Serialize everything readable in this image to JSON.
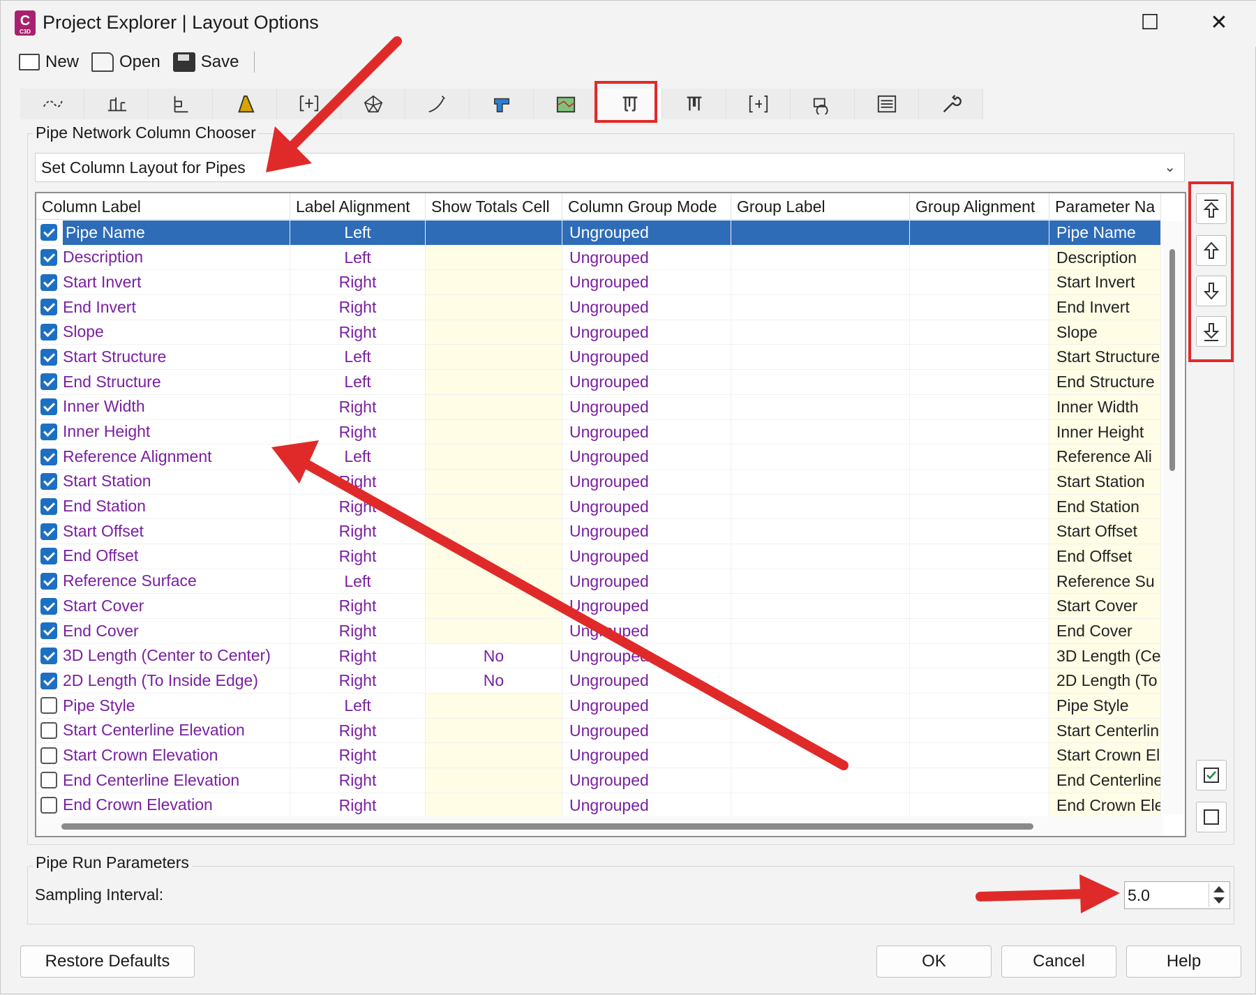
{
  "window": {
    "title": "Project Explorer | Layout Options",
    "app_icon_letter": "C",
    "app_icon_sub": "C3D",
    "maximize_glyph": "☐",
    "close_glyph": "✕"
  },
  "toolbar": {
    "new_label": "New",
    "open_label": "Open",
    "save_label": "Save"
  },
  "tabs": [
    {
      "icon": "alignment-icon"
    },
    {
      "icon": "profile-icon"
    },
    {
      "icon": "profile-view-icon"
    },
    {
      "icon": "corridor-icon"
    },
    {
      "icon": "sample-line-icon"
    },
    {
      "icon": "surface-icon"
    },
    {
      "icon": "feature-line-icon"
    },
    {
      "icon": "assembly-icon"
    },
    {
      "icon": "parcel-icon"
    },
    {
      "icon": "pipe-network-icon",
      "active": true
    },
    {
      "icon": "pressure-network-icon"
    },
    {
      "icon": "section-view-icon"
    },
    {
      "icon": "point-group-icon"
    },
    {
      "icon": "list-icon"
    },
    {
      "icon": "wrench-icon"
    }
  ],
  "chooser": {
    "group_label": "Pipe Network Column Chooser",
    "dropdown_value": "Set Column Layout for Pipes"
  },
  "grid": {
    "headers": [
      "Column Label",
      "Label Alignment",
      "Show Totals Cell",
      "Column Group Mode",
      "Group Label",
      "Group Alignment",
      "Parameter Na"
    ],
    "rows": [
      {
        "checked": true,
        "label": "Pipe Name",
        "align": "Left",
        "totals": "",
        "mode": "Ungrouped",
        "group": "",
        "galign": "",
        "param": "Pipe Name",
        "selected": true
      },
      {
        "checked": true,
        "label": "Description",
        "align": "Left",
        "totals": "",
        "mode": "Ungrouped",
        "group": "",
        "galign": "",
        "param": "Description"
      },
      {
        "checked": true,
        "label": "Start Invert",
        "align": "Right",
        "totals": "",
        "mode": "Ungrouped",
        "group": "",
        "galign": "",
        "param": "Start Invert"
      },
      {
        "checked": true,
        "label": "End Invert",
        "align": "Right",
        "totals": "",
        "mode": "Ungrouped",
        "group": "",
        "galign": "",
        "param": "End Invert"
      },
      {
        "checked": true,
        "label": "Slope",
        "align": "Right",
        "totals": "",
        "mode": "Ungrouped",
        "group": "",
        "galign": "",
        "param": "Slope"
      },
      {
        "checked": true,
        "label": "Start Structure",
        "align": "Left",
        "totals": "",
        "mode": "Ungrouped",
        "group": "",
        "galign": "",
        "param": "Start Structure"
      },
      {
        "checked": true,
        "label": "End Structure",
        "align": "Left",
        "totals": "",
        "mode": "Ungrouped",
        "group": "",
        "galign": "",
        "param": "End Structure"
      },
      {
        "checked": true,
        "label": "Inner Width",
        "align": "Right",
        "totals": "",
        "mode": "Ungrouped",
        "group": "",
        "galign": "",
        "param": "Inner Width"
      },
      {
        "checked": true,
        "label": "Inner Height",
        "align": "Right",
        "totals": "",
        "mode": "Ungrouped",
        "group": "",
        "galign": "",
        "param": "Inner Height"
      },
      {
        "checked": true,
        "label": "Reference Alignment",
        "align": "Left",
        "totals": "",
        "mode": "Ungrouped",
        "group": "",
        "galign": "",
        "param": "Reference Ali"
      },
      {
        "checked": true,
        "label": "Start Station",
        "align": "Right",
        "totals": "",
        "mode": "Ungrouped",
        "group": "",
        "galign": "",
        "param": "Start Station"
      },
      {
        "checked": true,
        "label": "End Station",
        "align": "Right",
        "totals": "",
        "mode": "Ungrouped",
        "group": "",
        "galign": "",
        "param": "End Station"
      },
      {
        "checked": true,
        "label": "Start Offset",
        "align": "Right",
        "totals": "",
        "mode": "Ungrouped",
        "group": "",
        "galign": "",
        "param": "Start Offset"
      },
      {
        "checked": true,
        "label": "End Offset",
        "align": "Right",
        "totals": "",
        "mode": "Ungrouped",
        "group": "",
        "galign": "",
        "param": "End Offset"
      },
      {
        "checked": true,
        "label": "Reference Surface",
        "align": "Left",
        "totals": "",
        "mode": "Ungrouped",
        "group": "",
        "galign": "",
        "param": "Reference Su"
      },
      {
        "checked": true,
        "label": "Start Cover",
        "align": "Right",
        "totals": "",
        "mode": "Ungrouped",
        "group": "",
        "galign": "",
        "param": "Start Cover"
      },
      {
        "checked": true,
        "label": "End Cover",
        "align": "Right",
        "totals": "",
        "mode": "Ungrouped",
        "group": "",
        "galign": "",
        "param": "End Cover"
      },
      {
        "checked": true,
        "label": "3D Length (Center to Center)",
        "align": "Right",
        "totals": "No",
        "mode": "Ungrouped",
        "group": "",
        "galign": "",
        "param": "3D Length (Ce"
      },
      {
        "checked": true,
        "label": "2D Length (To Inside Edge)",
        "align": "Right",
        "totals": "No",
        "mode": "Ungrouped",
        "group": "",
        "galign": "",
        "param": "2D Length (To"
      },
      {
        "checked": false,
        "label": "Pipe Style",
        "align": "Left",
        "totals": "",
        "mode": "Ungrouped",
        "group": "",
        "galign": "",
        "param": "Pipe Style"
      },
      {
        "checked": false,
        "label": "Start Centerline Elevation",
        "align": "Right",
        "totals": "",
        "mode": "Ungrouped",
        "group": "",
        "galign": "",
        "param": "Start Centerlin"
      },
      {
        "checked": false,
        "label": "Start Crown Elevation",
        "align": "Right",
        "totals": "",
        "mode": "Ungrouped",
        "group": "",
        "galign": "",
        "param": "Start Crown El"
      },
      {
        "checked": false,
        "label": "End Centerline Elevation",
        "align": "Right",
        "totals": "",
        "mode": "Ungrouped",
        "group": "",
        "galign": "",
        "param": "End Centerline"
      },
      {
        "checked": false,
        "label": "End Crown Elevation",
        "align": "Right",
        "totals": "",
        "mode": "Ungrouped",
        "group": "",
        "galign": "",
        "param": "End Crown Ele"
      }
    ]
  },
  "side_buttons": [
    {
      "icon": "move-to-top-icon"
    },
    {
      "icon": "move-up-icon"
    },
    {
      "icon": "move-down-icon"
    },
    {
      "icon": "move-to-bottom-icon"
    },
    {
      "icon": "check-all-icon"
    },
    {
      "icon": "uncheck-all-icon"
    }
  ],
  "pipe_run": {
    "group_label": "Pipe Run Parameters",
    "sampling_label": "Sampling Interval:",
    "sampling_value": "5.0"
  },
  "footer": {
    "restore_label": "Restore Defaults",
    "ok_label": "OK",
    "cancel_label": "Cancel",
    "help_label": "Help"
  },
  "colors": {
    "annotation_red": "#e02a2a",
    "selection_blue": "#2e6cb8",
    "checkbox_blue": "#1d6fc2",
    "label_purple": "#7a1fa2",
    "readonly_yellow": "#fffde6"
  }
}
